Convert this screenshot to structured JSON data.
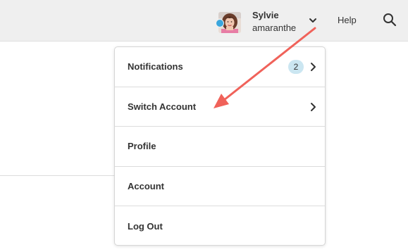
{
  "header": {
    "user": {
      "name": "Sylvie",
      "handle": "amaranthe",
      "presence_color": "#3aa6dd",
      "avatar_icon": "user-avatar-photo"
    },
    "menu_toggle_icon": "chevron-down-icon",
    "help_label": "Help",
    "search_icon": "search-icon"
  },
  "dropdown": {
    "items": [
      {
        "label": "Notifications",
        "badge": "2",
        "has_submenu": true
      },
      {
        "label": "Switch Account",
        "has_submenu": true
      },
      {
        "label": "Profile",
        "has_submenu": false
      },
      {
        "label": "Account",
        "has_submenu": false
      },
      {
        "label": "Log Out",
        "has_submenu": false
      }
    ]
  },
  "annotation": {
    "color": "#f0625a",
    "points_to": "Switch Account"
  }
}
